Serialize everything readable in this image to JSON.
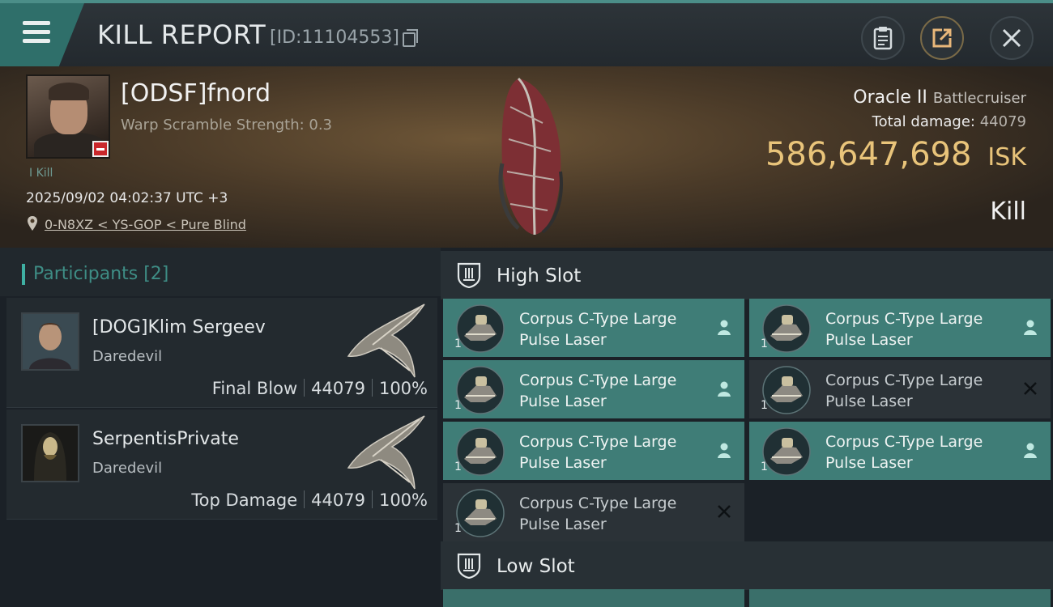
{
  "header": {
    "title": "KILL REPORT",
    "kill_id": "[ID:11104553]",
    "icons": [
      "menu-icon",
      "copy-icon",
      "clipboard-icon",
      "share-icon",
      "close-icon"
    ]
  },
  "victim": {
    "name": "[ODSF]fnord",
    "warp_scramble": "Warp Scramble Strength: 0.3",
    "kills_label": "I Kill",
    "datetime": "2025/09/02 04:02:37 UTC +3",
    "location": "0-N8XZ < YS-GOP < Pure Blind",
    "ship_name": "Oracle II",
    "ship_class": "Battlecruiser",
    "total_damage_label": "Total damage:",
    "total_damage_value": "44079",
    "isk_value": "586,647,698",
    "isk_unit": "ISK",
    "kill_type": "Kill"
  },
  "participants": {
    "title": "Participants [2]",
    "items": [
      {
        "name": "[DOG]Klim Sergeev",
        "ship": "Daredevil",
        "role": "Final Blow",
        "damage": "44079",
        "percent": "100%"
      },
      {
        "name": "SerpentisPrivate",
        "ship": "Daredevil",
        "role": "Top Damage",
        "damage": "44079",
        "percent": "100%"
      }
    ]
  },
  "high_slot": {
    "title": "High Slot",
    "modules": [
      {
        "line1": "Corpus C-Type Large",
        "line2": "Pulse Laser",
        "qty": "1",
        "state": "fitted"
      },
      {
        "line1": "Corpus C-Type Large",
        "line2": "Pulse Laser",
        "qty": "1",
        "state": "fitted"
      },
      {
        "line1": "Corpus C-Type Large",
        "line2": "Pulse Laser",
        "qty": "1",
        "state": "fitted"
      },
      {
        "line1": "Corpus C-Type Large",
        "line2": "Pulse Laser",
        "qty": "1",
        "state": "destroyed"
      },
      {
        "line1": "Corpus C-Type Large",
        "line2": "Pulse Laser",
        "qty": "1",
        "state": "fitted"
      },
      {
        "line1": "Corpus C-Type Large",
        "line2": "Pulse Laser",
        "qty": "1",
        "state": "fitted"
      },
      {
        "line1": "Corpus C-Type Large",
        "line2": "Pulse Laser",
        "qty": "1",
        "state": "destroyed"
      }
    ]
  },
  "low_slot": {
    "title": "Low Slot"
  },
  "colors": {
    "accent": "#3f7d77",
    "isk": "#e9c47a",
    "teal_text": "#3e8d85"
  }
}
